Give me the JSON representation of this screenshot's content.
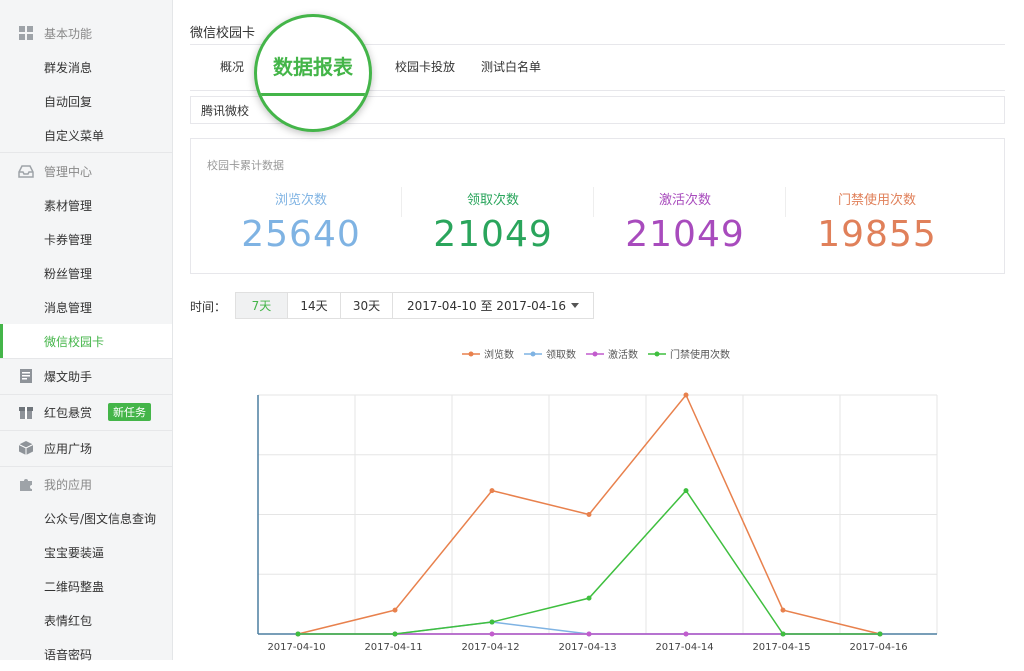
{
  "sidebar": {
    "sections": [
      {
        "label": "基本功能",
        "icon": "grid-icon",
        "items": [
          "群发消息",
          "自动回复",
          "自定义菜单"
        ]
      },
      {
        "label": "管理中心",
        "icon": "inbox-icon",
        "items": [
          "素材管理",
          "卡券管理",
          "粉丝管理",
          "消息管理",
          "微信校园卡"
        ]
      },
      {
        "label": "爆文助手",
        "icon": "document-icon",
        "items": []
      },
      {
        "label": "红包悬赏",
        "icon": "gift-icon",
        "badge": "新任务",
        "items": []
      },
      {
        "label": "应用广场",
        "icon": "box-icon",
        "items": []
      },
      {
        "label": "我的应用",
        "icon": "puzzle-icon",
        "items": [
          "公众号/图文信息查询",
          "宝宝要装逼",
          "二维码整蛊",
          "表情红包",
          "语音密码"
        ]
      }
    ],
    "active_item": "微信校园卡"
  },
  "page": {
    "title": "微信校园卡",
    "tabs": [
      "概况",
      "数据报表",
      "校园卡投放",
      "测试白名单"
    ],
    "active_tab": "数据报表",
    "school_select": "腾讯微校"
  },
  "stats": {
    "title": "校园卡累计数据",
    "items": [
      {
        "label": "浏览次数",
        "value": "25640",
        "color": "#7fb3e3"
      },
      {
        "label": "领取次数",
        "value": "21049",
        "color": "#2aa55c"
      },
      {
        "label": "激活次数",
        "value": "21049",
        "color": "#a84bbd"
      },
      {
        "label": "门禁使用次数",
        "value": "19855",
        "color": "#e0805a"
      }
    ]
  },
  "filter": {
    "time_label": "时间：",
    "ranges": [
      "7天",
      "14天",
      "30天"
    ],
    "active_range": "7天",
    "date_range": "2017-04-10 至 2017-04-16"
  },
  "chart_data": {
    "type": "line",
    "x": [
      "2017-04-10",
      "2017-04-11",
      "2017-04-12",
      "2017-04-13",
      "2017-04-14",
      "2017-04-15",
      "2017-04-16"
    ],
    "ylim": [
      0,
      4
    ],
    "grid": true,
    "legend_position": "top",
    "series": [
      {
        "name": "浏览数",
        "color": "#e8814d",
        "values": [
          0,
          0.4,
          2.4,
          2.0,
          4.0,
          0.4,
          0
        ]
      },
      {
        "name": "领取数",
        "color": "#7fb3e3",
        "values": [
          0,
          0,
          0.2,
          0,
          0,
          0,
          0
        ]
      },
      {
        "name": "激活数",
        "color": "#c25ccd",
        "values": [
          0,
          0,
          0,
          0,
          0,
          0,
          0
        ]
      },
      {
        "name": "门禁使用次数",
        "color": "#3fbf3f",
        "values": [
          0,
          0,
          0.2,
          0.6,
          2.4,
          0,
          0
        ]
      }
    ]
  }
}
